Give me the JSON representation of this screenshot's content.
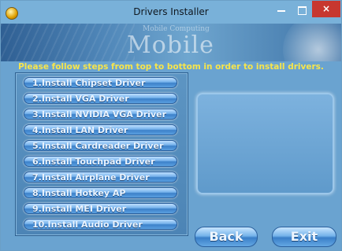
{
  "window": {
    "title": "Drivers Installer",
    "close_label": "×"
  },
  "banner": {
    "title": "Mobile Computing",
    "subtitle": "Mobile Computing"
  },
  "instructions": "Please follow steps from top to bottom in order to install drivers.",
  "drivers": [
    {
      "label": "1.Install Chipset Driver"
    },
    {
      "label": "2.Install VGA Driver"
    },
    {
      "label": "3.Install NVIDIA VGA Driver"
    },
    {
      "label": "4.Install LAN Driver"
    },
    {
      "label": "5.Install Cardreader Driver"
    },
    {
      "label": "6.Install Touchpad Driver"
    },
    {
      "label": "7.Install Airplane Driver"
    },
    {
      "label": "8.Install Hotkey AP"
    },
    {
      "label": "9.Install MEI Driver"
    },
    {
      "label": "10.Install Audio Driver"
    }
  ],
  "footer": {
    "back_label": "Back",
    "exit_label": "Exit"
  },
  "colors": {
    "instructions": "#f7e54b",
    "close": "#c7372f",
    "background": "#6aa3d0"
  },
  "icons": {
    "app": "app-icon",
    "minimize": "minimize-icon",
    "maximize": "maximize-icon",
    "close": "close-icon"
  }
}
